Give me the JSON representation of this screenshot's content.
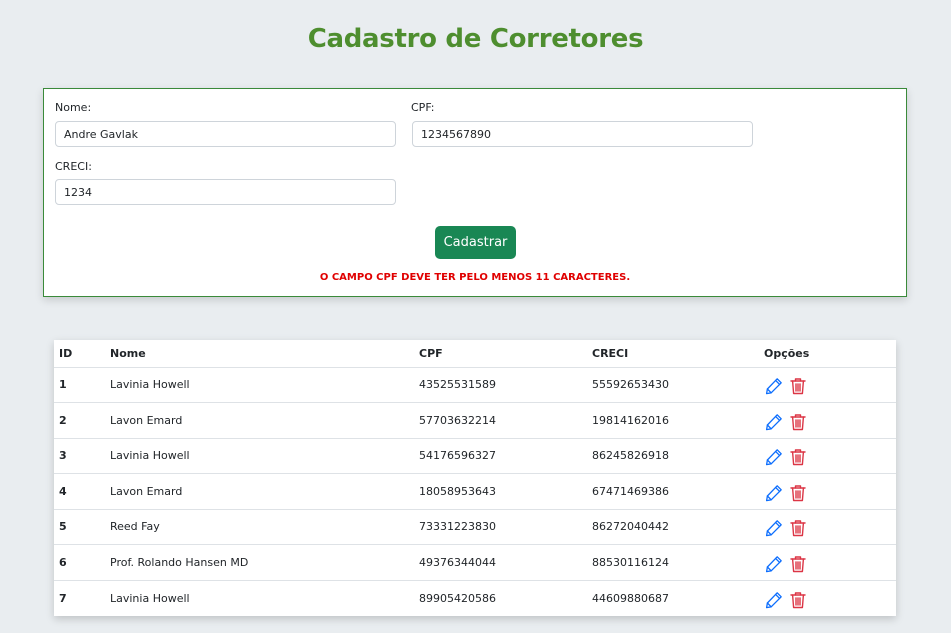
{
  "page": {
    "title": "Cadastro de Corretores"
  },
  "form": {
    "nome_label": "Nome:",
    "nome_value": "Andre Gavlak",
    "cpf_label": "CPF:",
    "cpf_value": "1234567890",
    "creci_label": "CRECI:",
    "creci_value": "1234",
    "submit_label": "Cadastrar",
    "error_message": "O campo CPF deve ter pelo menos 11 caracteres."
  },
  "table": {
    "headers": {
      "id": "ID",
      "nome": "Nome",
      "cpf": "CPF",
      "creci": "CRECI",
      "opcoes": "Opções"
    },
    "rows": [
      {
        "id": "1",
        "nome": "Lavinia Howell",
        "cpf": "43525531589",
        "creci": "55592653430"
      },
      {
        "id": "2",
        "nome": "Lavon Emard",
        "cpf": "57703632214",
        "creci": "19814162016"
      },
      {
        "id": "3",
        "nome": "Lavinia Howell",
        "cpf": "54176596327",
        "creci": "86245826918"
      },
      {
        "id": "4",
        "nome": "Lavon Emard",
        "cpf": "18058953643",
        "creci": "67471469386"
      },
      {
        "id": "5",
        "nome": "Reed Fay",
        "cpf": "73331223830",
        "creci": "86272040442"
      },
      {
        "id": "6",
        "nome": "Prof. Rolando Hansen MD",
        "cpf": "49376344044",
        "creci": "88530116124"
      },
      {
        "id": "7",
        "nome": "Lavinia Howell",
        "cpf": "89905420586",
        "creci": "44609880687"
      }
    ]
  },
  "icons": {
    "edit": "pencil-icon",
    "delete": "trash-icon"
  },
  "colors": {
    "title": "#4e8e2f",
    "button": "#198754",
    "error": "#e00000",
    "edit": "#0d6efd",
    "delete": "#dc3545"
  }
}
